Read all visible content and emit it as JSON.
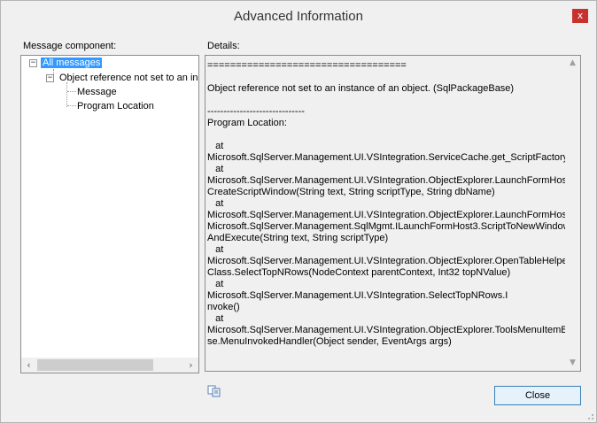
{
  "window": {
    "title": "Advanced Information",
    "close_glyph": "x"
  },
  "left_panel": {
    "label": "Message component:",
    "tree": {
      "root_label": "All messages",
      "child_label": "Object reference not set to an ins",
      "leaves": [
        "Message",
        "Program Location"
      ],
      "expander_glyph": "−"
    }
  },
  "right_panel": {
    "label": "Details:",
    "text": "===================================\n\nObject reference not set to an instance of an object. (SqlPackageBase)\n\n------------------------------\nProgram Location:\n\n   at\nMicrosoft.SqlServer.Management.UI.VSIntegration.ServiceCache.get_ScriptFactory()\n   at\nMicrosoft.SqlServer.Management.UI.VSIntegration.ObjectExplorer.LaunchFormHost.\nCreateScriptWindow(String text, String scriptType, String dbName)\n   at\nMicrosoft.SqlServer.Management.UI.VSIntegration.ObjectExplorer.LaunchFormHost.\nMicrosoft.SqlServer.Management.SqlMgmt.ILaunchFormHost3.ScriptToNewWindow\nAndExecute(String text, String scriptType)\n   at\nMicrosoft.SqlServer.Management.UI.VSIntegration.ObjectExplorer.OpenTableHelper\nClass.SelectTopNRows(NodeContext parentContext, Int32 topNValue)\n   at\nMicrosoft.SqlServer.Management.UI.VSIntegration.SelectTopNRows.I\nnvoke()\n   at\nMicrosoft.SqlServer.Management.UI.VSIntegration.ObjectExplorer.ToolsMenuItemBa\nse.MenuInvokedHandler(Object sender, EventArgs args)"
  },
  "footer": {
    "close_button": "Close"
  },
  "icons": {
    "close": "close-icon",
    "copy": "copy-icon",
    "scroll_left": "arrow-left-icon",
    "scroll_right": "arrow-right-icon",
    "scroll_up": "arrow-up-icon",
    "scroll_down": "arrow-down-icon"
  },
  "colors": {
    "selection": "#3399ff",
    "close_button_bg": "#c7312e",
    "button_border": "#3c7fb1",
    "button_bg": "#e5f1fb"
  }
}
